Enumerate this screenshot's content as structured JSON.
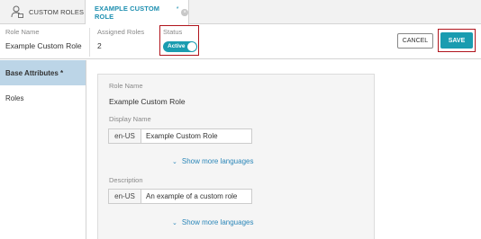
{
  "tabs": {
    "roles_label": "CUSTOM ROLES",
    "active_label": "EXAMPLE CUSTOM ROLE",
    "unsaved_marker": "*",
    "close_glyph": "×"
  },
  "header": {
    "role_name_label": "Role Name",
    "role_name_value": "Example Custom Role",
    "assigned_roles_label": "Assigned Roles",
    "assigned_roles_value": "2",
    "status_label": "Status",
    "status_toggle_label": "Active",
    "status_active": true,
    "cancel_label": "CANCEL",
    "save_label": "SAVE"
  },
  "sidebar": {
    "items": [
      {
        "label": "Base Attributes *",
        "active": true
      },
      {
        "label": "Roles",
        "active": false
      }
    ]
  },
  "panel": {
    "role_name_label": "Role Name",
    "role_name_value": "Example Custom Role",
    "display_name_label": "Display Name",
    "display_name_lang": "en-US",
    "display_name_value": "Example Custom Role",
    "show_more_1": "Show more languages",
    "description_label": "Description",
    "description_lang": "en-US",
    "description_value": "An example of a custom role",
    "show_more_2": "Show more languages"
  },
  "colors": {
    "accent": "#1a9cb0",
    "highlight_border": "#b0141c",
    "sidebar_active": "#bcd5e7",
    "link": "#2a86b8"
  },
  "icons": [
    "user-roles-icon",
    "close-icon",
    "chevron-down-icon"
  ]
}
